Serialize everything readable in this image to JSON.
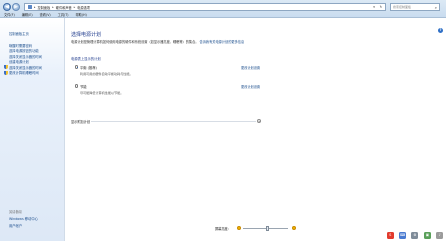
{
  "address": {
    "crumbs": [
      "控制面板",
      "硬件和声音",
      "电源选项"
    ],
    "search_placeholder": "搜索控制面板"
  },
  "menu": [
    "文件(F)",
    "编辑(E)",
    "查看(V)",
    "工具(T)",
    "帮助(H)"
  ],
  "sidebar": {
    "home": "控制面板主页",
    "links": [
      "唤醒时需要密码",
      "选择电源按钮的功能",
      "选择关闭显示器的时间",
      "创建电源计划",
      "选择关闭显示器的时间",
      "更改计算机睡眠时间"
    ],
    "see_also_title": "另请参阅",
    "see_also": [
      "Windows 移动中心",
      "用户帐户"
    ]
  },
  "main": {
    "title": "选择电源计划",
    "description": "电源计划是管理计算机如何使用电源的硬件和系统设置（如显示器亮度、睡眠等）的集合。",
    "description_link": "告诉我有关电源计划的更多信息",
    "section_label": "电源表上显示的计划",
    "plans": [
      {
        "name": "平衡 (推荐)",
        "desc": "利用可用的硬件自动平衡功耗与性能。",
        "selected": true,
        "settings": "更改计划设置"
      },
      {
        "name": "节能",
        "desc": "尽可能降低计算机性能以节能。",
        "selected": false,
        "settings": "更改计划设置"
      }
    ],
    "show_more": "显示附加计划"
  },
  "brightness": {
    "label": "屏幕亮度:",
    "level": 0.55
  },
  "colors": {
    "accent": "#1e3a8c",
    "link": "#1a4d8c"
  }
}
